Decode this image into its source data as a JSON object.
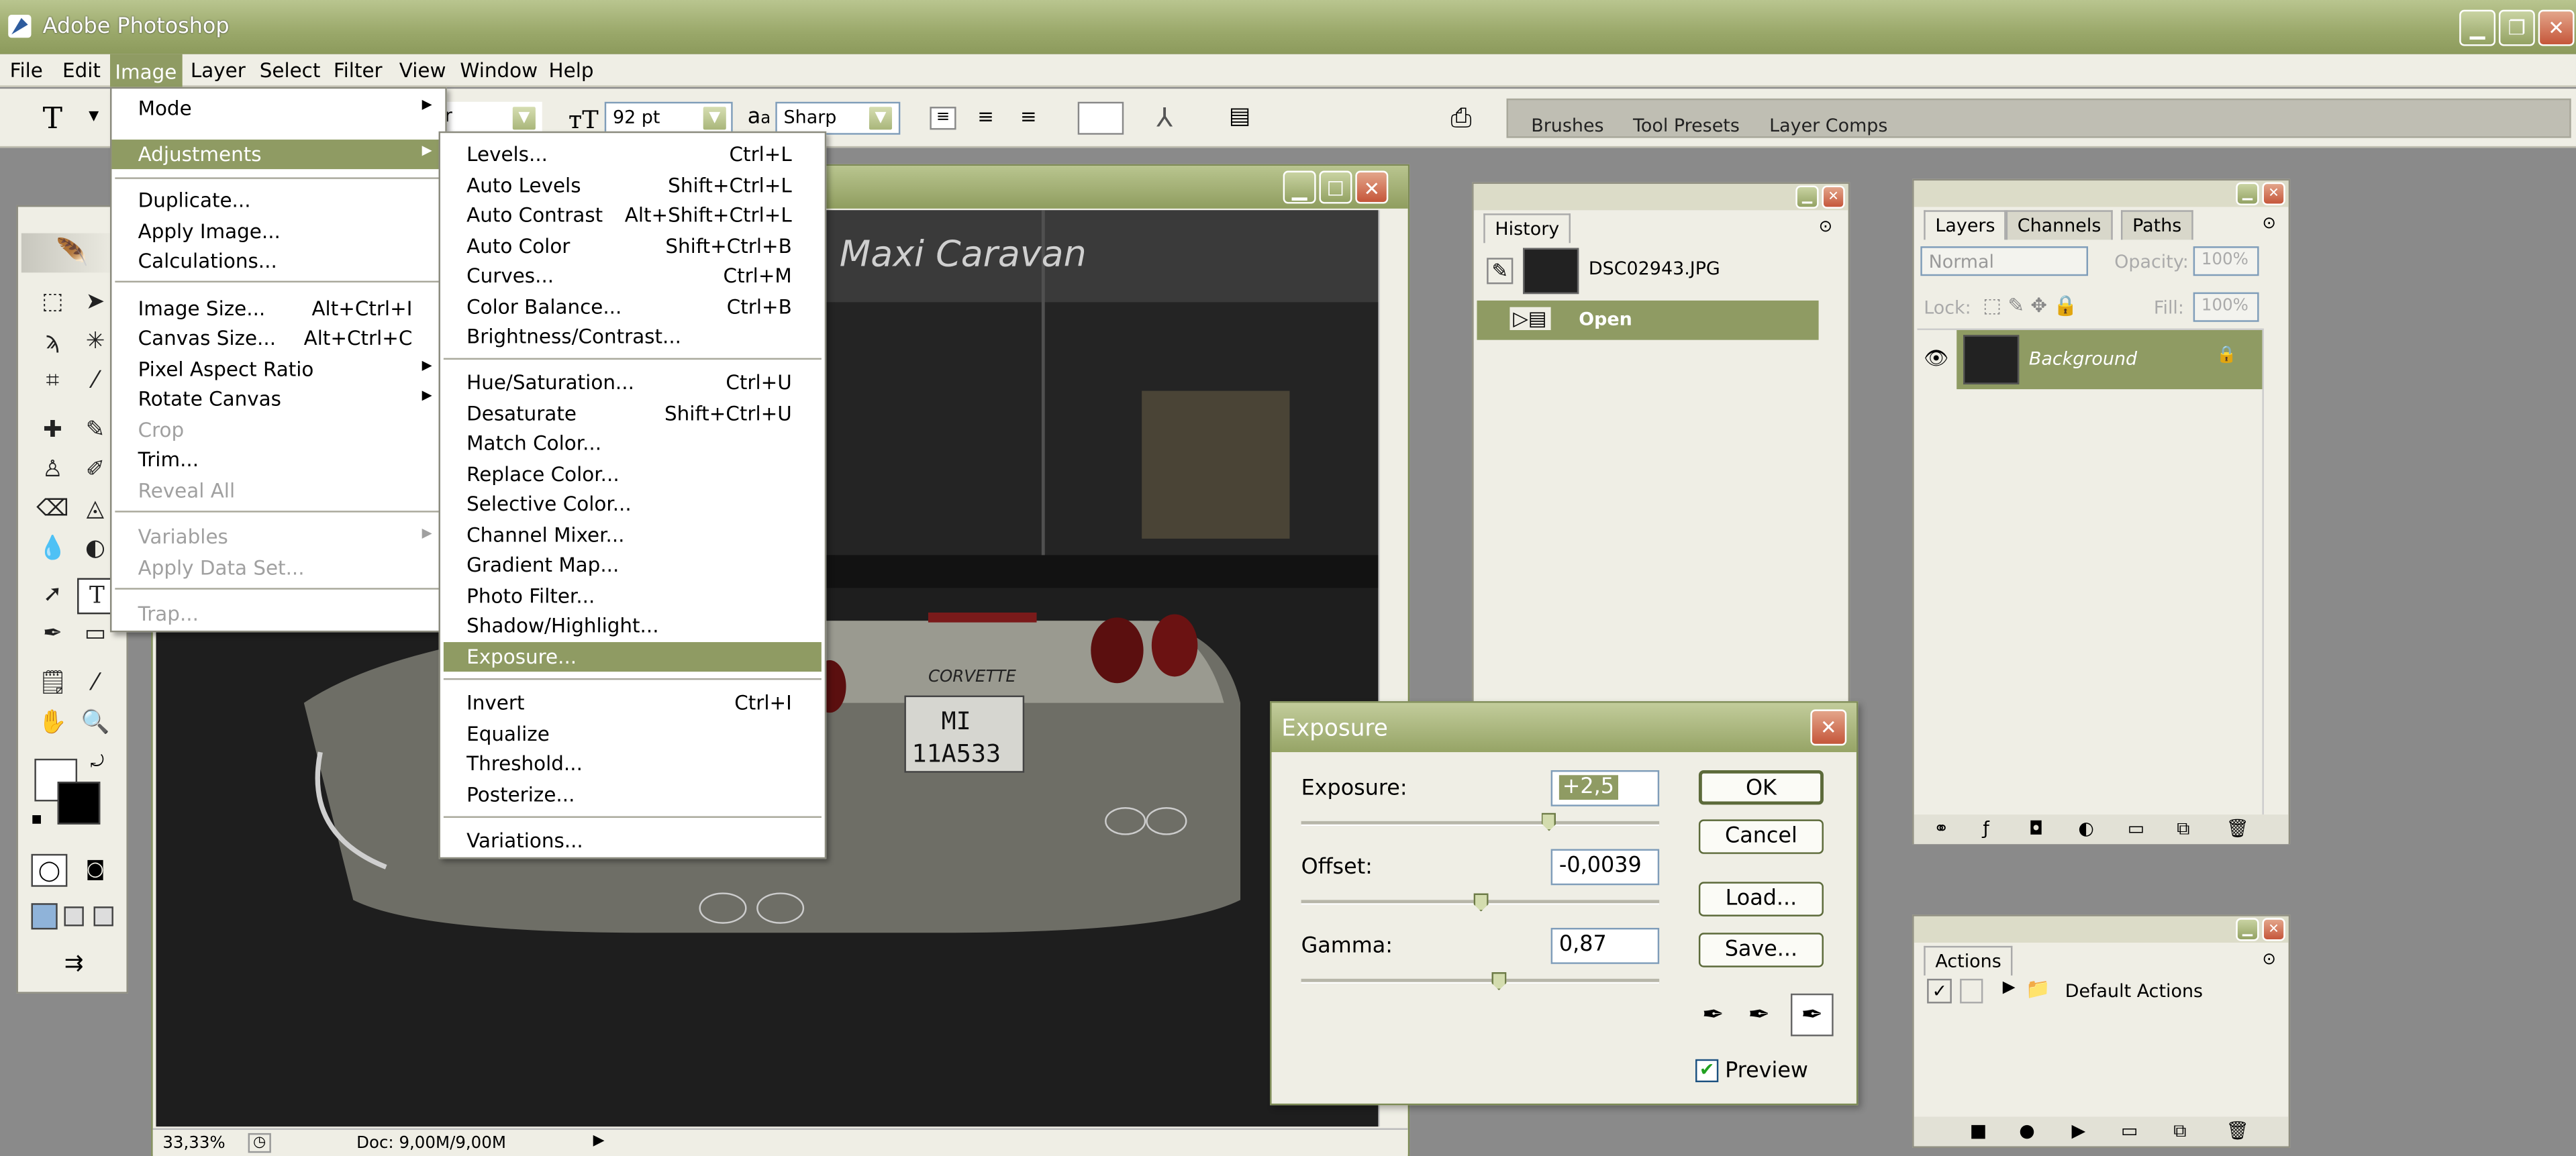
{
  "app": {
    "title": "Adobe Photoshop"
  },
  "menubar": [
    "File",
    "Edit",
    "Image",
    "Layer",
    "Select",
    "Filter",
    "View",
    "Window",
    "Help"
  ],
  "options": {
    "font_style": "ular",
    "font_size": "92 pt",
    "antialias": "Sharp",
    "aa_glyph": "a"
  },
  "palette_well": {
    "tabs": [
      "Brushes",
      "Tool Presets",
      "Layer Comps"
    ]
  },
  "image_menu": [
    {
      "label": "Mode",
      "arrow": "▶"
    },
    {
      "label": "Adjustments",
      "arrow": "▶"
    },
    {
      "label": "Duplicate..."
    },
    {
      "label": "Apply Image..."
    },
    {
      "label": "Calculations..."
    },
    {
      "label": "Image Size...",
      "shortcut": "Alt+Ctrl+I"
    },
    {
      "label": "Canvas Size...",
      "shortcut": "Alt+Ctrl+C"
    },
    {
      "label": "Pixel Aspect Ratio",
      "arrow": "▶"
    },
    {
      "label": "Rotate Canvas",
      "arrow": "▶"
    },
    {
      "label": "Crop"
    },
    {
      "label": "Trim..."
    },
    {
      "label": "Reveal All"
    },
    {
      "label": "Variables",
      "arrow": "▶"
    },
    {
      "label": "Apply Data Set..."
    },
    {
      "label": "Trap..."
    }
  ],
  "adjustments_menu": [
    {
      "label": "Levels...",
      "shortcut": "Ctrl+L"
    },
    {
      "label": "Auto Levels",
      "shortcut": "Shift+Ctrl+L"
    },
    {
      "label": "Auto Contrast",
      "shortcut": "Alt+Shift+Ctrl+L"
    },
    {
      "label": "Auto Color",
      "shortcut": "Shift+Ctrl+B"
    },
    {
      "label": "Curves...",
      "shortcut": "Ctrl+M"
    },
    {
      "label": "Color Balance...",
      "shortcut": "Ctrl+B"
    },
    {
      "label": "Brightness/Contrast..."
    },
    {
      "label": "Hue/Saturation...",
      "shortcut": "Ctrl+U"
    },
    {
      "label": "Desaturate",
      "shortcut": "Shift+Ctrl+U"
    },
    {
      "label": "Match Color..."
    },
    {
      "label": "Replace Color..."
    },
    {
      "label": "Selective Color..."
    },
    {
      "label": "Channel Mixer..."
    },
    {
      "label": "Gradient Map..."
    },
    {
      "label": "Photo Filter..."
    },
    {
      "label": "Shadow/Highlight..."
    },
    {
      "label": "Exposure..."
    },
    {
      "label": "Invert",
      "shortcut": "Ctrl+I"
    },
    {
      "label": "Equalize"
    },
    {
      "label": "Threshold..."
    },
    {
      "label": "Posterize..."
    },
    {
      "label": "Variations..."
    }
  ],
  "photo": {
    "sign_text": "Maxi Caravan",
    "badge_text": "CORVETTE",
    "plate_line1": "MI",
    "plate_line2": "11A533"
  },
  "document": {
    "zoom": "33,33%",
    "doc_size": "Doc: 9,00M/9,00M"
  },
  "history": {
    "tab": "History",
    "snapshot": "DSC02943.JPG",
    "state": "Open"
  },
  "layers": {
    "tabs": [
      "Layers",
      "Channels",
      "Paths"
    ],
    "blend_mode": "Normal",
    "opacity_label": "Opacity:",
    "opacity_value": "100%",
    "lock_label": "Lock:",
    "fill_label": "Fill:",
    "fill_value": "100%",
    "layer_name": "Background"
  },
  "actions": {
    "tab": "Actions",
    "set_name": "Default Actions"
  },
  "exposure_dialog": {
    "title": "Exposure",
    "exposure_label": "Exposure:",
    "exposure_value": "+2,5",
    "offset_label": "Offset:",
    "offset_value": "-0,0039",
    "gamma_label": "Gamma:",
    "gamma_value": "0,87",
    "ok": "OK",
    "cancel": "Cancel",
    "load": "Load...",
    "save": "Save...",
    "preview_label": "Preview",
    "preview_checked": true,
    "exposure_slider_fraction": 0.69,
    "offset_slider_fraction": 0.5,
    "gamma_slider_fraction": 0.55
  },
  "colors": {
    "accent": "#8f9b63",
    "title_bar": "#9aa86a",
    "close_red": "#c5563a"
  }
}
